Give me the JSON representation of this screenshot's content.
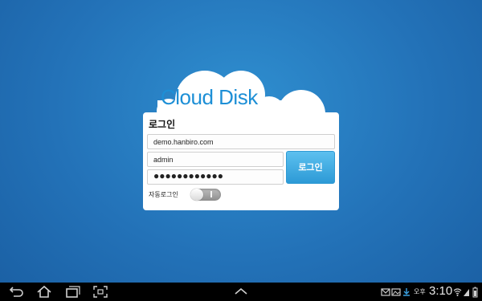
{
  "app": {
    "title": "Cloud Disk"
  },
  "login": {
    "heading": "로그인",
    "domain_value": "demo.hanbiro.com",
    "username_value": "admin",
    "password_mask": "●●●●●●●●●●●●",
    "button_label": "로그인",
    "auto_login_label": "자동로그인",
    "auto_login_on": false
  },
  "statusbar": {
    "ampm": "오후",
    "time": "3:10"
  },
  "navbar": {
    "icons": [
      "back-icon",
      "home-icon",
      "recent-apps-icon",
      "screenshot-icon",
      "chevron-up-icon"
    ],
    "status_icons": [
      "email-icon",
      "gallery-icon",
      "download-icon",
      "wifi-icon",
      "signal-icon",
      "battery-icon"
    ]
  },
  "colors": {
    "background": "#2372b8",
    "accent": "#1d8fd6",
    "button": "#2d9ad6"
  }
}
